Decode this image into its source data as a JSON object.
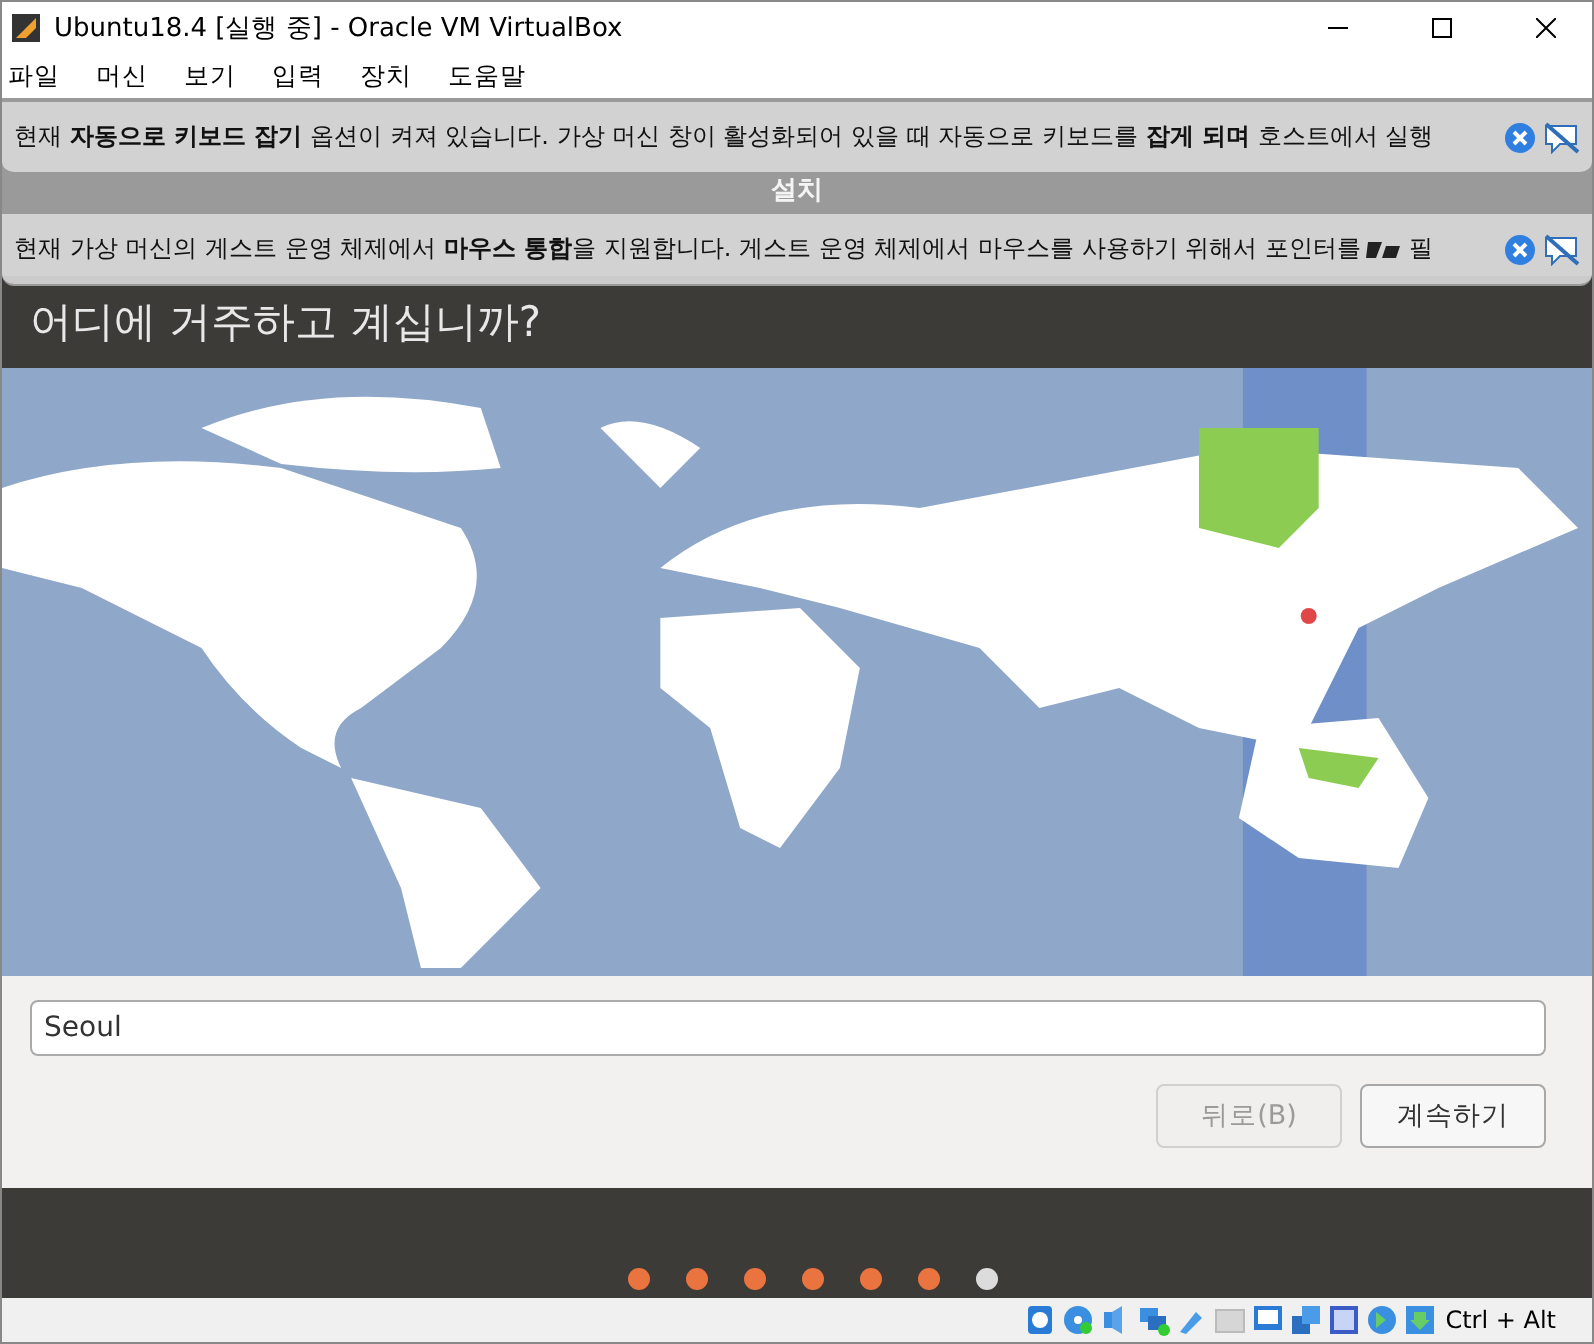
{
  "window": {
    "title": "Ubuntu18.4 [실행 중] - Oracle VM VirtualBox"
  },
  "menu": [
    "파일",
    "머신",
    "보기",
    "입력",
    "장치",
    "도움말"
  ],
  "guest": {
    "top_bar_title": "설치",
    "notifications": [
      {
        "text": "현재 **자동으로 키보드 잡기** 옵션이 켜져 있습니다. 가상 머신 창이 활성화되어 있을 때 자동으로 키보드를 **잡게 되며** 호스트에서 실행"
      },
      {
        "text": "현재 가상 머신의 게스트 운영 체제에서 **마우스 통합**을 지원합니다. 게스트 운영 체제에서 마우스를 사용하기 위해서 포인터를",
        "tail": "필"
      }
    ],
    "heading": "어디에 거주하고 계십니까?",
    "location": {
      "value": "Seoul"
    },
    "buttons": [
      {
        "label": "뒤로(B)",
        "disabled": true
      },
      {
        "label": "계속하기",
        "disabled": false
      }
    ],
    "progress": [
      {
        "completed": true
      },
      {
        "completed": true
      },
      {
        "completed": true
      },
      {
        "completed": true
      },
      {
        "completed": true
      },
      {
        "completed": true
      },
      {
        "completed": false
      }
    ]
  },
  "status_bar": {
    "host_key": "Ctrl + Alt"
  }
}
